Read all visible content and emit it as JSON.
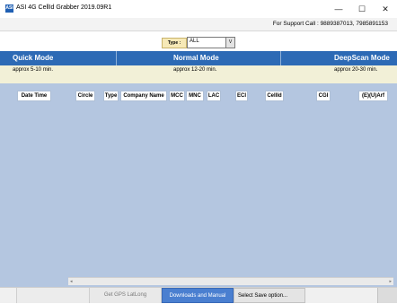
{
  "window": {
    "title": "ASI 4G CellId Grabber 2019.09R1",
    "app_icon_text": "ASI",
    "minimize": "—",
    "maximize": "☐",
    "close": "✕"
  },
  "support": {
    "text": "For Support Call : 9889387013, 7985891153"
  },
  "type_filter": {
    "label": "Type :",
    "value": "ALL",
    "arrow": "V"
  },
  "modes": [
    {
      "name": "Quick Mode",
      "approx": "approx 5-10 min."
    },
    {
      "name": "Normal Mode",
      "approx": "approx 12-20 min."
    },
    {
      "name": "DeepScan Mode",
      "approx": "approx 20-30 min."
    }
  ],
  "table": {
    "columns": [
      "Date Time",
      "Circle",
      "Type",
      "Company Name",
      "MCC",
      "MNC",
      "LAC",
      "ECI",
      "CellId",
      "CGI",
      "(E)(U)Arf"
    ]
  },
  "scroll": {
    "left_arrow": "◂",
    "right_arrow": "▸"
  },
  "bottom": {
    "gps_button": "Get GPS LatLong",
    "downloads_button": "Downloads and Manual",
    "save_select": "Select Save option..."
  },
  "colors": {
    "mode_bar": "#2d6ab5",
    "table_bg": "#b4c6e0",
    "approx_bg": "#f2f0d7",
    "downloads_btn": "#4a7fd0"
  }
}
